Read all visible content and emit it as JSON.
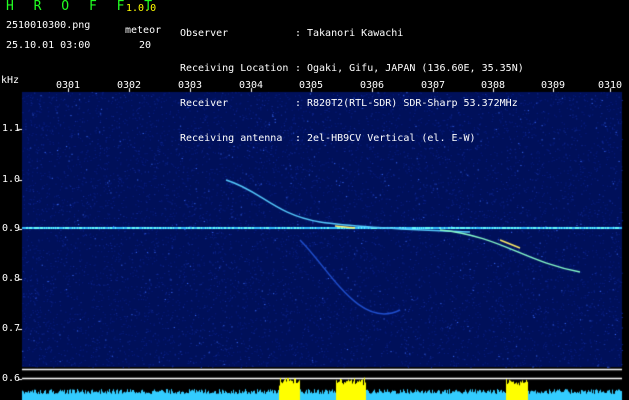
{
  "app": {
    "name": "H R O F F T",
    "version": "1.0.0"
  },
  "file": {
    "name": "2510010300.png",
    "datetime": "25.10.01 03:00"
  },
  "meteor": {
    "label": "meteor",
    "count": "20"
  },
  "info": [
    {
      "key": "Observer",
      "value": "Takanori Kawachi"
    },
    {
      "key": "Receiving Location",
      "value": "Ogaki, Gifu, JAPAN (136.60E, 35.35N)"
    },
    {
      "key": "Receiver",
      "value": "R820T2(RTL-SDR) SDR-Sharp 53.372MHz"
    },
    {
      "key": "Receiving antenna",
      "value": "2el-HB9CV Vertical (el. E-W)"
    }
  ],
  "axis": {
    "y_unit": "kHz",
    "x_ticks": [
      "0301",
      "0302",
      "0303",
      "0304",
      "0305",
      "0306",
      "0307",
      "0308",
      "0309",
      "0310"
    ],
    "y_ticks": [
      "1.1",
      "1.0",
      "0.9",
      "0.8",
      "0.7",
      "0.6"
    ]
  },
  "colors": {
    "logo": "#22ff22",
    "version": "#ffff00",
    "signal": "#66ffff",
    "hist": "#33ccff",
    "hist_hi": "#ffff00"
  }
}
